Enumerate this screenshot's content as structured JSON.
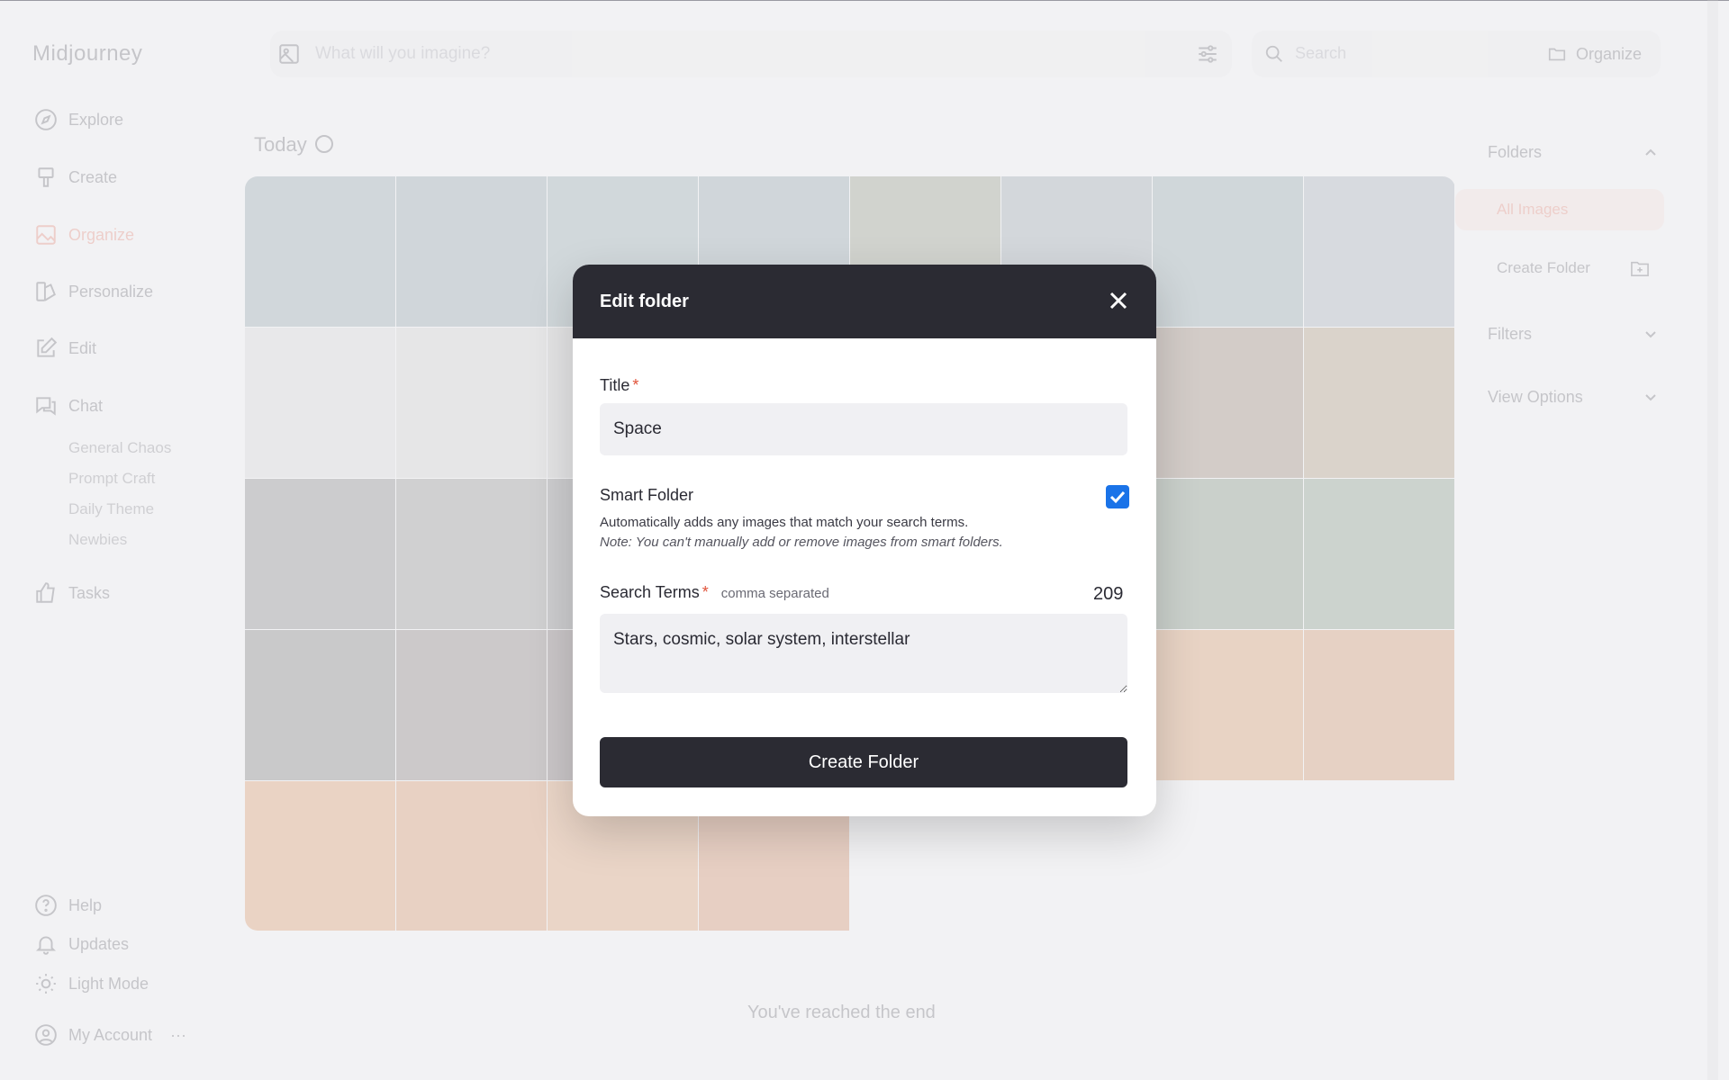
{
  "app": {
    "logo": "Midjourney",
    "accent_color": "#e0533a",
    "nav": [
      {
        "label": "Explore",
        "icon": "compass-icon"
      },
      {
        "label": "Create",
        "icon": "paintbrush-icon"
      },
      {
        "label": "Organize",
        "icon": "image-icon",
        "active": true
      },
      {
        "label": "Personalize",
        "icon": "personalize-icon"
      },
      {
        "label": "Edit",
        "icon": "edit-icon"
      },
      {
        "label": "Chat",
        "icon": "chat-icon"
      },
      {
        "label": "Tasks",
        "icon": "thumbs-up-icon"
      }
    ],
    "chat_rooms": [
      "General Chaos",
      "Prompt Craft",
      "Daily Theme",
      "Newbies"
    ],
    "bottom_nav": [
      {
        "label": "Help",
        "icon": "help-icon"
      },
      {
        "label": "Updates",
        "icon": "bell-icon"
      },
      {
        "label": "Light Mode",
        "icon": "sun-icon"
      },
      {
        "label": "My Account",
        "icon": "account-icon"
      }
    ],
    "prompt_placeholder": "What will you imagine?",
    "search_placeholder": "Search",
    "organize_label": "Organize",
    "section_title": "Today",
    "right_panel": {
      "folders_title": "Folders",
      "all_images": "All Images",
      "create_folder": "Create Folder",
      "filters_title": "Filters",
      "view_options_title": "View Options"
    },
    "end_text": "You've reached the end"
  },
  "modal": {
    "title": "Edit folder",
    "title_label": "Title",
    "required_mark": "*",
    "title_value": "Space",
    "smart_folder_label": "Smart Folder",
    "smart_folder_checked": true,
    "smart_folder_desc": "Automatically adds any images that match your search terms.",
    "smart_folder_note": "Note: You can't manually add or remove images from smart folders.",
    "search_terms_label": "Search Terms",
    "search_terms_hint": "comma separated",
    "search_terms_counter": "209",
    "search_terms_value": "Stars, cosmic, solar system, interstellar",
    "submit_label": "Create Folder",
    "checkbox_color": "#1a73e8"
  }
}
